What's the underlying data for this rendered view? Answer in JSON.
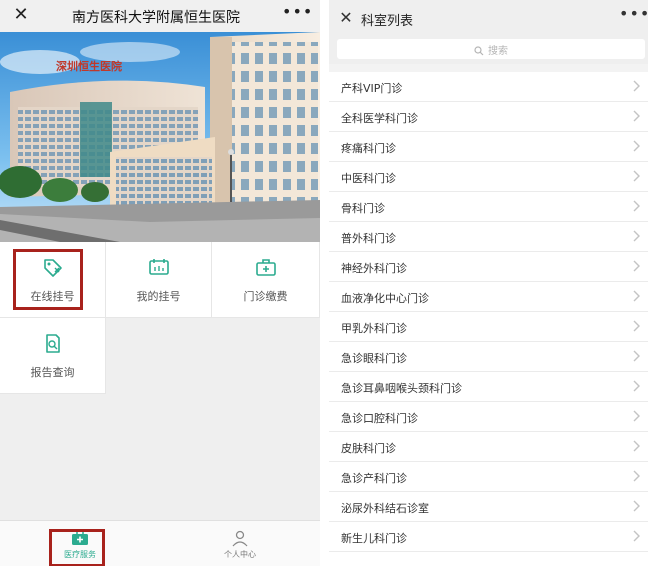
{
  "left": {
    "header": {
      "title": "南方医科大学附属恒生医院",
      "close_icon": "close-icon",
      "more_icon": "more-dots-icon"
    },
    "banner": {
      "sign_text": "深圳恒生医院"
    },
    "grid": [
      {
        "label": "在线挂号",
        "icon": "tag-icon",
        "highlighted": true
      },
      {
        "label": "我的挂号",
        "icon": "register-card-icon",
        "highlighted": false
      },
      {
        "label": "门诊缴费",
        "icon": "medical-kit-icon",
        "highlighted": false
      },
      {
        "label": "报告查询",
        "icon": "report-search-icon",
        "highlighted": false
      }
    ],
    "tabbar": [
      {
        "label": "医疗服务",
        "icon": "medical-kit-icon",
        "active": true
      },
      {
        "label": "个人中心",
        "icon": "user-icon",
        "active": false
      }
    ],
    "accent": "#2bab8f",
    "highlight_color": "#a8221c"
  },
  "right": {
    "header": {
      "title": "科室列表",
      "close_icon": "close-icon",
      "more_icon": "more-dots-icon"
    },
    "search": {
      "placeholder": "搜索",
      "icon": "search-icon"
    },
    "departments": [
      "产科VIP门诊",
      "全科医学科门诊",
      "疼痛科门诊",
      "中医科门诊",
      "骨科门诊",
      "普外科门诊",
      "神经外科门诊",
      "血液净化中心门诊",
      "甲乳外科门诊",
      "急诊眼科门诊",
      "急诊耳鼻咽喉头颈科门诊",
      "急诊口腔科门诊",
      "皮肤科门诊",
      "急诊产科门诊",
      "泌尿外科结石诊室",
      "新生儿科门诊"
    ]
  }
}
